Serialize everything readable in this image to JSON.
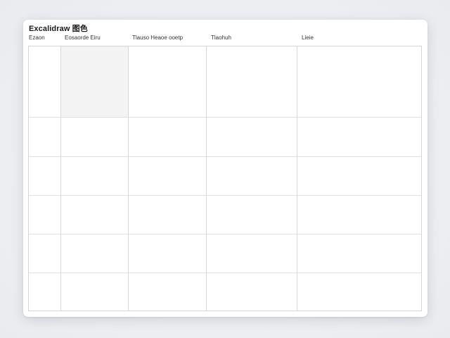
{
  "window": {
    "title": "Excalidraw 图色"
  },
  "table": {
    "columns": [
      {
        "label": "Ezaon"
      },
      {
        "label": "Eosaorde  Eiru"
      },
      {
        "label": "Tlauso  Heaoe ooetp"
      },
      {
        "label": "Tlaohuh"
      },
      {
        "label": "Lieie"
      }
    ],
    "row_count": 6,
    "highlighted_cell": {
      "row": 0,
      "column": 1
    }
  },
  "colors": {
    "background": "#eef0f3",
    "window": "#ffffff",
    "grid_line": "#d9d9d9",
    "shaded_cell": "#f3f3f3"
  }
}
